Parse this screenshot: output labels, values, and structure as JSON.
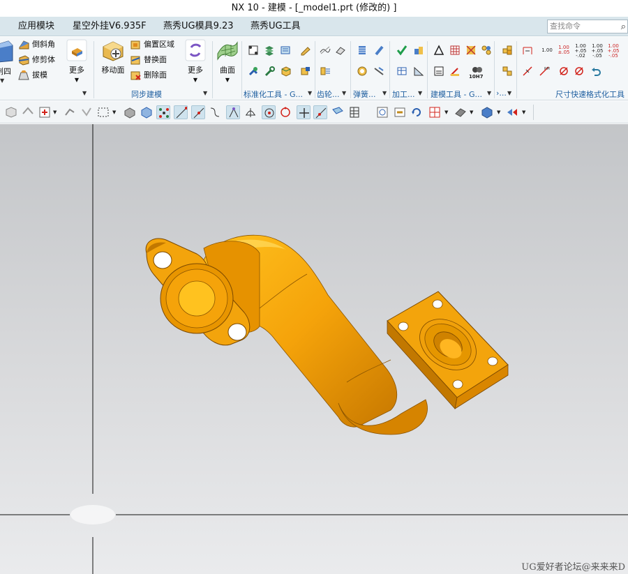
{
  "window": {
    "title": "NX 10 - 建模 - [_model1.prt  (修改的) ]"
  },
  "menu": {
    "partial_tab": " ",
    "tabs": [
      "应用模块",
      "星空外挂V6.935F",
      "燕秀UG模具9.23",
      "燕秀UG工具"
    ],
    "search_placeholder": "查找命令"
  },
  "ribbon": {
    "cut_label": "剖四",
    "feature_small": [
      "倒斜角",
      "修剪体",
      "拔模"
    ],
    "more1": "更多",
    "move_face": "移动面",
    "sync_small": [
      "偏置区域",
      "替换面",
      "删除面"
    ],
    "more2": "更多",
    "sync_group": "同步建模",
    "surface": "曲面",
    "groups": [
      "标准化工具 - G...",
      "齿轮...",
      "弹簧...",
      "加工...",
      "建模工具 - G...",
      "›..."
    ],
    "dim_group": "尺寸快速格式化工具",
    "tol_values": [
      "1.00",
      "1.00\n±.05",
      "1.00\n+.05\n-.02",
      "1.00\n+.05\n-.05",
      "1.00\n+.05\n-.05"
    ],
    "fit_label": "10H7"
  },
  "viewport": {
    "watermark": "UG爱好者论坛@来来来D",
    "model_color": "#f5a30a"
  }
}
